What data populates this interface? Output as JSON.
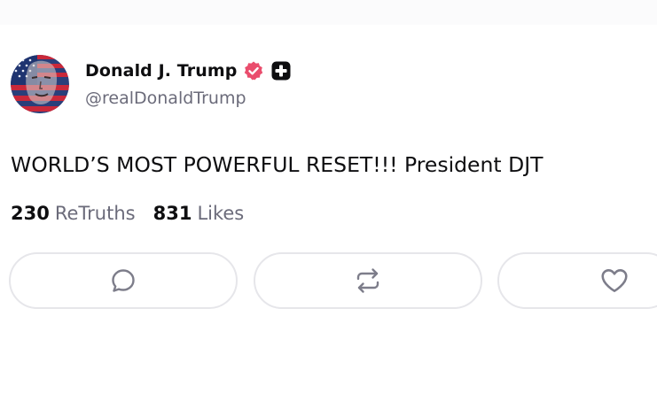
{
  "author": {
    "display_name": "Donald J. Trump",
    "handle": "@realDonaldTrump",
    "verified_icon": "verified-badge-icon",
    "plus_icon": "plus-badge-icon",
    "verified_color": "#ea4d6d"
  },
  "post": {
    "text": "WORLD’S MOST POWERFUL RESET!!! President DJT"
  },
  "stats": {
    "retruths_count": "230",
    "retruths_label": "ReTruths",
    "likes_count": "831",
    "likes_label": "Likes"
  },
  "actions": [
    {
      "name": "reply",
      "icon": "reply-icon"
    },
    {
      "name": "retruth",
      "icon": "retruth-icon"
    },
    {
      "name": "like",
      "icon": "heart-icon"
    }
  ],
  "colors": {
    "text": "#0e0e10",
    "muted": "#6b6b7a",
    "border": "#e6e6ea"
  }
}
